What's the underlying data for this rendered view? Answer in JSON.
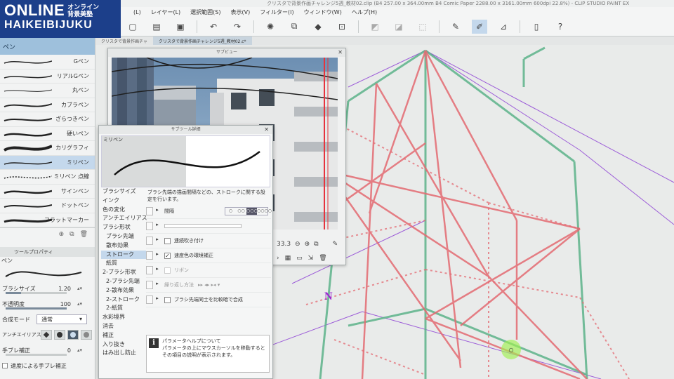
{
  "logo": {
    "main": "ONLINE",
    "jp": "オンライン\n背景美塾",
    "sub": "HAIKEIBIJUKU"
  },
  "window": {
    "title": "クリスタで背景作画チャレンジ5週_教材02.clip (B4 257.00 x 364.00mm B4 Comic Paper 2288.00 x 3161.00mm 600dpi 22.8%) - CLIP STUDIO PAINT EX"
  },
  "menu": [
    "(L)",
    "レイヤー(L)",
    "選択範囲(S)",
    "表示(V)",
    "フィルター(I)",
    "ウィンドウ(W)",
    "ヘルプ(H)"
  ],
  "toolbar": {
    "icons": [
      "new-file-icon",
      "open-icon",
      "save-icon",
      "undo-icon",
      "redo-icon",
      "erase-icon",
      "clear-icon",
      "fill-icon",
      "transform-icon",
      "deselect-icon",
      "invert-icon",
      "selection-icon",
      "pen-icon",
      "brush-icon",
      "ruler-icon",
      "device-icon",
      "help-icon"
    ]
  },
  "doc_tabs": [
    "クリスタで背景作画チャ",
    "クリスタで背景作画チャレンジ5週_教材02.c*"
  ],
  "sub_tool": {
    "header": "ペン",
    "brushes": [
      {
        "name": "Gペン",
        "selected": false
      },
      {
        "name": "リアルGペン",
        "selected": false
      },
      {
        "name": "丸ペン",
        "selected": false
      },
      {
        "name": "カブラペン",
        "selected": false
      },
      {
        "name": "ざらつきペン",
        "selected": false
      },
      {
        "name": "硬いペン",
        "selected": false
      },
      {
        "name": "カリグラフィ",
        "selected": false
      },
      {
        "name": "ミリペン",
        "selected": true
      },
      {
        "name": "ミリペン 点線",
        "selected": false
      },
      {
        "name": "サインペン",
        "selected": false
      },
      {
        "name": "ドットペン",
        "selected": false
      },
      {
        "name": "フラットマーカー",
        "selected": false
      }
    ]
  },
  "tool_property": {
    "header": "ツールプロパティ",
    "tool_name": "ペン",
    "brush_size_label": "ブラシサイズ",
    "brush_size_value": "1.20",
    "brush_size_fraction": 0.25,
    "opacity_label": "不透明度",
    "opacity_value": "100",
    "blend_label": "合成モード",
    "blend_value": "通常",
    "aa_label": "アンチエイリアス",
    "stabilization_label": "手ブレ補正",
    "stabilization_value": "0",
    "speed_stab_label": "速度による手ブレ補正"
  },
  "subview": {
    "title": "サブビュー",
    "zoom": "33.3"
  },
  "detail": {
    "title": "サブツール詳細",
    "preview_name": "ミリペン",
    "categories": [
      {
        "label": "ブラシサイズ",
        "indent": false,
        "selected": false
      },
      {
        "label": "インク",
        "indent": false,
        "selected": false
      },
      {
        "label": "色の変化",
        "indent": false,
        "selected": false
      },
      {
        "label": "アンチエイリアス",
        "indent": false,
        "selected": false
      },
      {
        "label": "ブラシ形状",
        "indent": false,
        "selected": false
      },
      {
        "label": "ブラシ先端",
        "indent": true,
        "selected": false
      },
      {
        "label": "散布効果",
        "indent": true,
        "selected": false
      },
      {
        "label": "ストローク",
        "indent": true,
        "selected": true
      },
      {
        "label": "紙質",
        "indent": true,
        "selected": false
      },
      {
        "label": "2-ブラシ形状",
        "indent": false,
        "selected": false
      },
      {
        "label": "2-ブラシ先端",
        "indent": true,
        "selected": false
      },
      {
        "label": "2-散布効果",
        "indent": true,
        "selected": false
      },
      {
        "label": "2-ストローク",
        "indent": true,
        "selected": false
      },
      {
        "label": "2-紙質",
        "indent": true,
        "selected": false
      },
      {
        "label": "水彩境界",
        "indent": false,
        "selected": false
      },
      {
        "label": "消去",
        "indent": false,
        "selected": false
      },
      {
        "label": "補正",
        "indent": false,
        "selected": false
      },
      {
        "label": "入り抜き",
        "indent": false,
        "selected": false
      },
      {
        "label": "はみ出し防止",
        "indent": false,
        "selected": false
      }
    ],
    "description": "ブラシ先端の描画間隔などの、ストロークに関する設定を行います。",
    "interval_label": "間隔",
    "interval_options": [
      "○",
      "○○",
      "○○○",
      "○○○○"
    ],
    "continuous_spray_label": "連続吹き付け",
    "speed_alpha_label": "速度色の環境補正",
    "ribbon_label": "リボン",
    "repeat_label": "繰り返し方法",
    "compose_label": "ブラシ先端同士を比較暗で合成",
    "help_title": "パラメータヘルプについて",
    "help_text": "パラメータの上にマウスカーソルを移動するとその項目の説明が表示されます。"
  },
  "canvas": {
    "ref_text": "N"
  },
  "colors": {
    "accent": "#1c3f8a",
    "selected": "#c4d8ec",
    "red_lines": "#e46a72",
    "green_lines": "#5db38a",
    "purple_lines": "#8a3ad4"
  }
}
